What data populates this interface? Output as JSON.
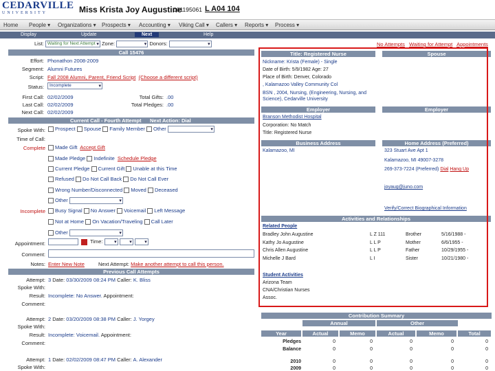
{
  "header": {
    "logo_top": "CEDARVILLE",
    "logo_bottom": "UNIVERSITY",
    "name": "Miss Krista Joy Augustine",
    "id": "001195061",
    "code": "L A04 104"
  },
  "nav": {
    "items": [
      "Home",
      "People",
      "Organizations",
      "Prospects",
      "Accounting",
      "Viking Call",
      "Callers",
      "Reports",
      "Process"
    ]
  },
  "subnav": {
    "items": [
      "Display",
      "Update",
      "Next",
      "Help"
    ],
    "active": "Next"
  },
  "list": {
    "label": "List:",
    "value": "Waiting for Next Attempt",
    "zone_label": "Zone:",
    "donors_label": "Donors:"
  },
  "top_links": [
    "No Attempts",
    "Waiting for Attempt",
    "Appointments"
  ],
  "call": {
    "title": "Call 15476",
    "effort_label": "Effort:",
    "effort": "Phonathon 2008-2009",
    "segment_label": "Segment:",
    "segment": "Alumni Futures",
    "script_label": "Script:",
    "script": "Fall 2008 Alumni, Parent, Friend Script",
    "script_alt": "(Choose a different script)",
    "status_label": "Status:",
    "status": "Incomplete",
    "first_label": "First Call:",
    "first": "02/02/2009",
    "last_label": "Last Call:",
    "last": "02/02/2009",
    "next_label": "Next Call:",
    "next": "02/02/2009",
    "gifts_label": "Total Gifts:",
    "gifts": ".00",
    "pledges_label": "Total Pledges:",
    "pledges": ".00"
  },
  "current": {
    "title": "Current Call - Fourth Attempt",
    "next_action": "Next Action: Dial",
    "spoke_label": "Spoke With:",
    "spoke_opts": [
      "Prospect",
      "Spouse",
      "Family Member",
      "Other"
    ],
    "time_label": "Time of Call:",
    "complete_label": "Complete",
    "c1": "Made Gift",
    "c1b": "Accept Gift",
    "c2": "Made Pledge",
    "c2b": "Indefinite",
    "c2c": "Schedule Pledge",
    "c3": "Current Pledge",
    "c3b": "Current Gift",
    "c3c": "Unable at this Time",
    "c4": "Refused",
    "c4b": "Do Not Call Back",
    "c4c": "Do Not Call Ever",
    "c5": "Wrong Number/Disconnected",
    "c5b": "Moved",
    "c5c": "Deceased",
    "c6": "Other",
    "incomplete_label": "Incomplete",
    "i1": "Busy Signal",
    "i1b": "No Answer",
    "i1c": "Voicemail",
    "i1d": "Left Message",
    "i2": "Not at Home",
    "i2b": "On Vacation/Traveling",
    "i2c": "Call Later",
    "i3": "Other",
    "appt_label": "Appointment:",
    "time2": "Time:",
    "comment_label": "Comment:",
    "notes_label": "Notes:",
    "notes_link": "Enter New Note",
    "next_attempt_label": "Next Attempt:",
    "next_attempt_link": "Make another attempt to call this person."
  },
  "previous": {
    "title": "Previous Call Attempts",
    "items": [
      {
        "attempt": "3",
        "date": "03/30/2009 08:24 PM",
        "caller": "K. Bliss",
        "result": "Incomplete: No Answer.",
        "appt": "Appointment:"
      },
      {
        "attempt": "2",
        "date": "03/20/2009 08:38 PM",
        "caller": "J. Yorgey",
        "result": "Incomplete: Voicemail.",
        "appt": "Appointment:"
      },
      {
        "attempt": "1",
        "date": "02/02/2009 08:47 PM",
        "caller": "A. Alexander",
        "result": "",
        "appt": ""
      }
    ],
    "attempt_label": "Attempt:",
    "date_label": "Date:",
    "caller_label": "Caller:",
    "spoke_label": "Spoke With:",
    "result_label": "Result:",
    "comment_label": "Comment:"
  },
  "prospect": {
    "title": "Title: Registered Nurse",
    "spouse_title": "Spouse",
    "nick": "Nickname: Krista  (Female)  - Single",
    "dob": "Date of Birth: 5/9/1982   Age: 27",
    "pob": "Place of Birth: Denver, Colorado",
    "school": ", Kalamazoo Valley Community Col",
    "degree": "BSN , 2004, Nursing, (Engineering, Nursing, and Science), Cedarville University",
    "employer_title": "Employer",
    "employer2_title": "Employer",
    "employer": "Branson Methodist Hospital",
    "corp": "Corporation: No Match",
    "biz_title": "Business Address",
    "home_title": "Home Address (Preferred)",
    "biz_city": "Kalamazoo, MI",
    "home1": "323 Stuart Ave Apt 1",
    "home2": "Kalamazoo, MI 49007-3278",
    "phone": "269-373-7224 (Preferred)",
    "dial": "Dial",
    "hangup": "Hang Up",
    "email": "joyaug@juno.com",
    "verify": "Verify/Correct Biographical Information",
    "act_title": "Activities and Relationships",
    "related_title": "Related People",
    "related": [
      [
        "Bradley John Augustine",
        "L Z 111",
        "Brother",
        "5/16/1988 -"
      ],
      [
        "Kathy Jo Augustine",
        "L L P",
        "Mother",
        "6/6/1955 -"
      ],
      [
        "Chris Allen Augustine",
        "L L P",
        "Father",
        "10/29/1955 -"
      ],
      [
        "Michelle J Bard",
        "L I",
        "Sister",
        "10/21/1980 -"
      ]
    ],
    "student_title": "Student Activities",
    "student": [
      "Arizona Team",
      "CNA/Christian Nurses",
      "Assoc."
    ]
  },
  "contrib": {
    "title": "Contribution Summary",
    "annual": "Annual",
    "other": "Other",
    "cols": [
      "Year",
      "Actual",
      "Memo",
      "Actual",
      "Memo",
      "Total"
    ],
    "rows": [
      [
        "Pledges",
        "0",
        "0",
        "0",
        "0",
        "0"
      ],
      [
        "Balance",
        "0",
        "0",
        "0",
        "0",
        "0"
      ],
      [
        "",
        "",
        " ",
        " ",
        " ",
        " "
      ],
      [
        "2010",
        "0",
        "0",
        "0",
        "0",
        "0"
      ],
      [
        "2009",
        "0",
        "0",
        "0",
        "0",
        "0"
      ]
    ]
  }
}
